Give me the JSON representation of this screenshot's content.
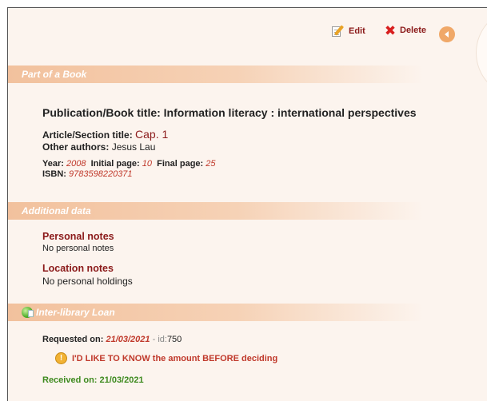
{
  "toolbar": {
    "edit_label": "Edit",
    "delete_label": "Delete"
  },
  "sections": {
    "book": {
      "header": "Part of a Book",
      "publication_label": "Publication/Book title:",
      "publication_value": "Information literacy : international perspectives",
      "article_label": "Article/Section title:",
      "article_value": "Cap. 1",
      "authors_label": "Other authors:",
      "authors_value": "Jesus Lau",
      "year_label": "Year:",
      "year_value": "2008",
      "initial_label": "Initial page:",
      "initial_value": "10",
      "final_label": "Final page:",
      "final_value": "25",
      "isbn_label": "ISBN:",
      "isbn_value": "9783598220371"
    },
    "additional": {
      "header": "Additional data",
      "personal_label": "Personal notes",
      "personal_value": "No personal notes",
      "location_label": "Location notes",
      "location_value": "No personal holdings"
    },
    "ill": {
      "header": "Inter-library Loan",
      "requested_label": "Requested on:",
      "requested_value": "21/03/2021",
      "id_sep": " - ",
      "id_label": "id:",
      "id_value": "750",
      "warning_text": "I'D LIKE TO KNOW the amount BEFORE deciding",
      "received_label": "Received on:",
      "received_value": "21/03/2021"
    }
  },
  "icons": {
    "edit": "edit-icon",
    "delete": "delete-icon",
    "back": "back-icon",
    "ill": "inter-library-loan-icon",
    "warning": "warning-icon"
  },
  "colors": {
    "background": "#fcf4ee",
    "header_gradient": "#f2c19d",
    "accent_maroon": "#8b1a1a",
    "value_red": "#c0392b",
    "received_green": "#3e8a1f",
    "back_button": "#f0a868"
  }
}
